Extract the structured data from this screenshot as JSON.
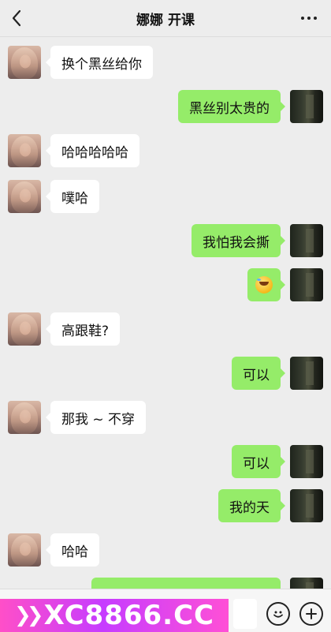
{
  "header": {
    "title": "娜娜  开课",
    "back_icon": "chevron-left-icon",
    "more_icon": "more-dots-icon"
  },
  "messages": [
    {
      "side": "left",
      "text": "换个黑丝给你"
    },
    {
      "side": "right",
      "text": "黑丝别太贵的"
    },
    {
      "side": "left",
      "text": "哈哈哈哈哈"
    },
    {
      "side": "left",
      "text": "噗哈"
    },
    {
      "side": "right",
      "text": "我怕我会撕"
    },
    {
      "side": "right",
      "emoji": "laughing-tears-emoji"
    },
    {
      "side": "left",
      "text": "高跟鞋?"
    },
    {
      "side": "right",
      "text": "可以"
    },
    {
      "side": "left",
      "text": "那我 ~ 不穿"
    },
    {
      "side": "right",
      "text": "可以"
    },
    {
      "side": "right",
      "text": "我的天"
    },
    {
      "side": "left",
      "text": "哈哈"
    }
  ],
  "bottom_bar": {
    "ad_text": "XC8866.CC",
    "ad_arrows": "❯❯",
    "emoji_icon": "smiley-icon",
    "plus_icon": "plus-circle-icon"
  },
  "colors": {
    "background": "#ededed",
    "bubble_sent": "#95ec69",
    "bubble_received": "#ffffff",
    "ad_gradient_start": "#ff4fc8",
    "ad_gradient_mid": "#c63cff"
  }
}
